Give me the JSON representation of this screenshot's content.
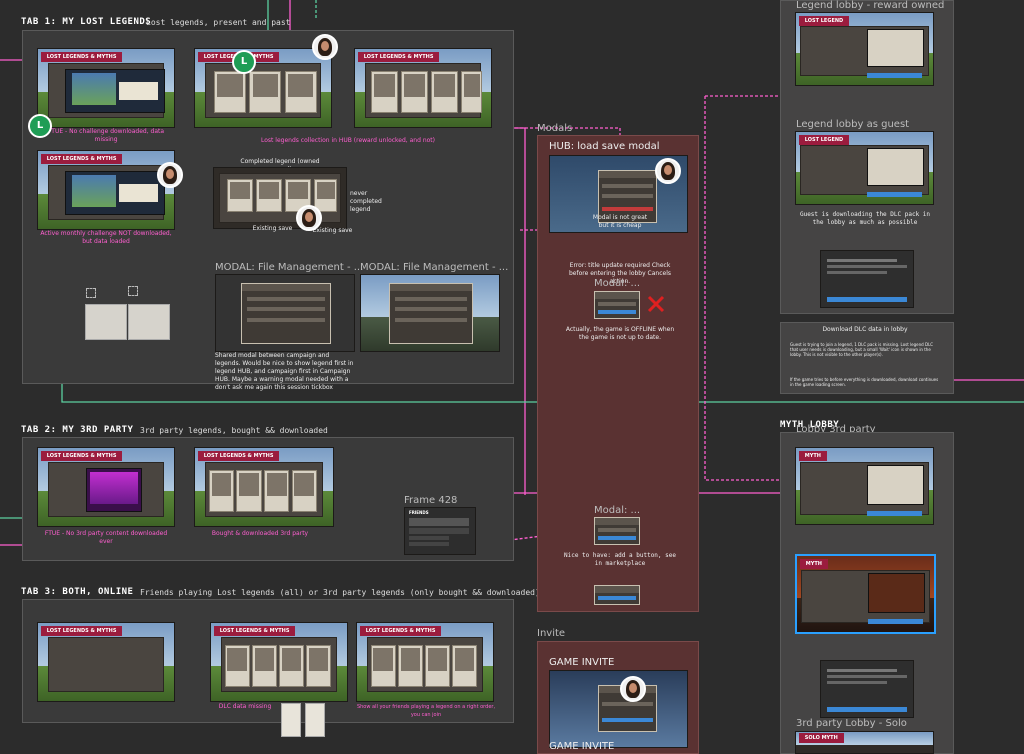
{
  "canvas": {
    "background": "#2c2c2c",
    "accent_pink": "#ff5fd0",
    "accent_green": "#5bd0a0",
    "ribbon_red": "#9b1c3e"
  },
  "tab1": {
    "title": "TAB 1: MY LOST LEGENDS",
    "subtitle": "Lost legends, present and past",
    "notes": {
      "ftue": "FTUE - No challenge downloaded, data missing",
      "collection": "Lost legends collection in HUB (reward unlocked, and not)",
      "active": "Active monthly challenge NOT downloaded, but data loaded",
      "completed": "Completed legend (owned reward)",
      "never": "never completed legend",
      "existing_save": "Existing save",
      "existing_save2": "Existing save",
      "shared_modal": "Shared modal between campaign and legends. Would be nice to show legend first in legend HUB, and campaign first in Campaign HUB. Maybe a warning modal needed with a don't ask me again this session tickbox"
    },
    "frames": {
      "file_mgmt_1": "MODAL: File Management - ...",
      "file_mgmt_2": "MODAL: File Management - ..."
    },
    "screen_label": "LOST LEGENDS & MYTHS"
  },
  "tab2": {
    "title": "TAB 2: MY 3RD PARTY",
    "subtitle": "3rd party legends, bought && downloaded",
    "notes": {
      "ftue": "FTUE - No 3rd party content downloaded ever",
      "bought": "Bought & downloaded 3rd party"
    },
    "frame_428": "Frame 428",
    "friends_label": "FRIENDS"
  },
  "tab3": {
    "title": "TAB 3: BOTH, ONLINE",
    "subtitle": "Friends playing Lost legends (all) or 3rd party legends (only bought && downloaded)",
    "notes": {
      "dlc_missing": "DLC data missing",
      "show_all": "Show all your friends playing a legend on a right order, you can join"
    }
  },
  "modals": {
    "section_label": "Modals",
    "hub_title": "HUB: load save modal",
    "hub_note": "Modal is not great but it is cheap",
    "error_note": "Error: title update required Check before entering the lobby Cancels action.",
    "modal_frame": "Modal: ...",
    "offline_note": "Actually, the game is OFFLINE when the game is not up to date.",
    "modal_frame2": "Modal: ...",
    "nice_note": "Nice to have: add a button, see in marketplace"
  },
  "invite": {
    "section_label": "Invite",
    "title": "GAME INVITE",
    "title2": "GAME INVITE"
  },
  "right": {
    "reward_owned": "Legend lobby - reward owned",
    "as_guest": "Legend lobby as guest",
    "guest_note": "Guest is downloading the DLC pack in the lobby as much as possible",
    "download_title": "Download DLC data in lobby",
    "download_note1": "Guest is trying to join a legend, 1 DLC pack is missing. Lost legend DLC that user needs is downloading, but a small 'Wait' icon is shown in the lobby. This is not visible to the other player(s).",
    "download_note2": "If the game tries to before everything is downloaded, download continues in the game loading screen.",
    "myth_lobby": "MYTH LOBBY",
    "lobby_3rd": "Lobby 3rd party",
    "solo": "3rd party Lobby - Solo",
    "myth_ribbon": "MYTH",
    "lost_legend_ribbon": "LOST LEGEND",
    "solo_ribbon": "SOLO MYTH"
  },
  "badges": {
    "letter": "L"
  }
}
